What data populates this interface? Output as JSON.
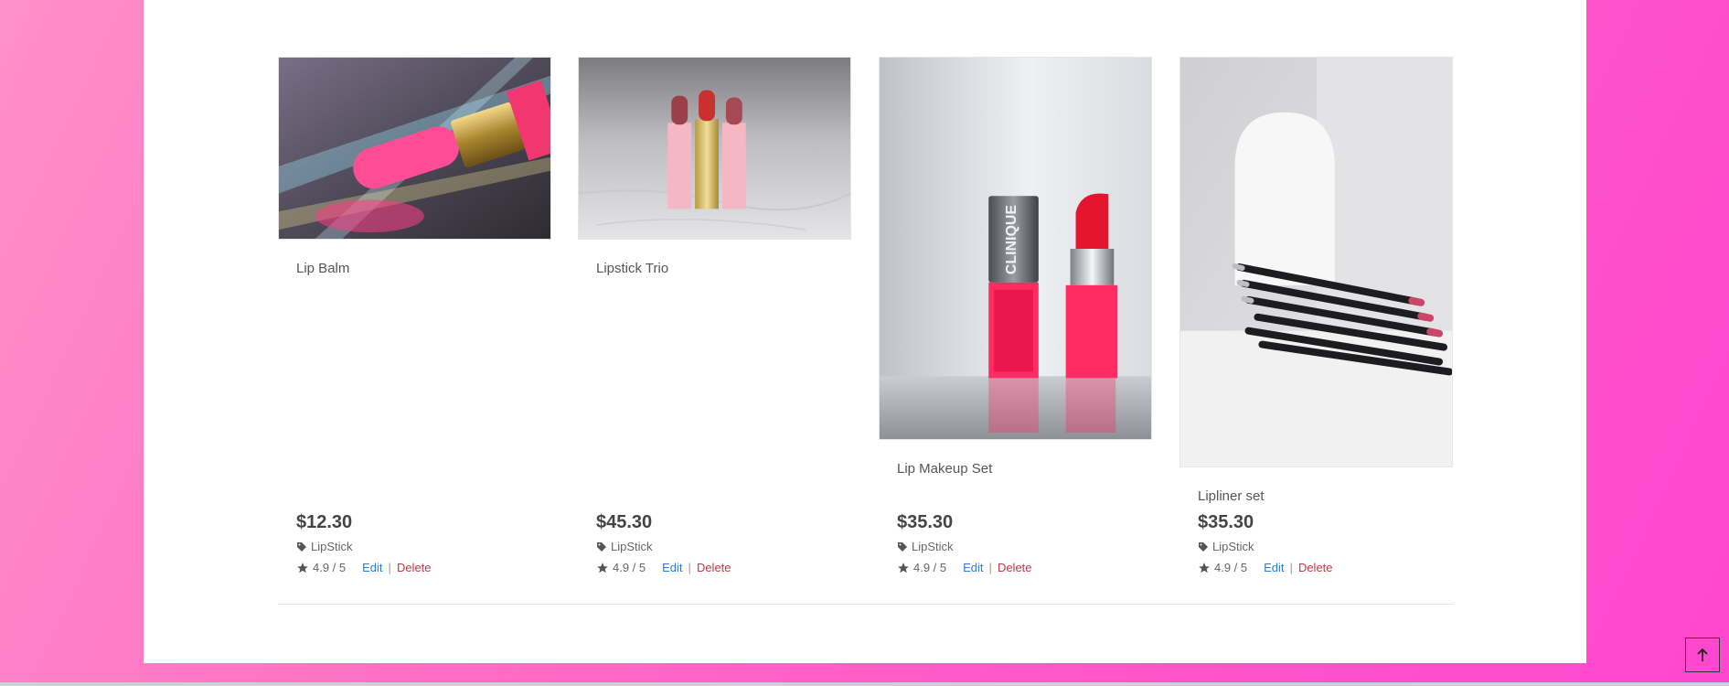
{
  "products": [
    {
      "title": "Lip Balm",
      "price": "$12.30",
      "category": "LipStick",
      "rating": "4.9 / 5",
      "edit_label": "Edit",
      "separator": "|",
      "delete_label": "Delete",
      "image": "lip-balm-photo"
    },
    {
      "title": "Lipstick Trio",
      "price": "$45.30",
      "category": "LipStick",
      "rating": "4.9 / 5",
      "edit_label": "Edit",
      "separator": "|",
      "delete_label": "Delete",
      "image": "lipstick-trio-photo"
    },
    {
      "title": "Lip Makeup Set",
      "price": "$35.30",
      "category": "LipStick",
      "rating": "4.9 / 5",
      "edit_label": "Edit",
      "separator": "|",
      "delete_label": "Delete",
      "image": "lip-makeup-set-photo",
      "brand_text": "CLINIQUE"
    },
    {
      "title": "Lipliner set",
      "price": "$35.30",
      "category": "LipStick",
      "rating": "4.9 / 5",
      "edit_label": "Edit",
      "separator": "|",
      "delete_label": "Delete",
      "image": "lipliner-set-photo"
    }
  ],
  "icons": {
    "category": "tag-icon",
    "rating": "star-icon",
    "scroll_top": "arrow-up-icon"
  },
  "colors": {
    "background_gradient_start": "#ff8fc9",
    "background_gradient_end": "#ff47cf",
    "panel": "#ffffff",
    "edit_link": "#2a7fd0",
    "delete_link": "#c0394b",
    "price_text": "#444444"
  }
}
